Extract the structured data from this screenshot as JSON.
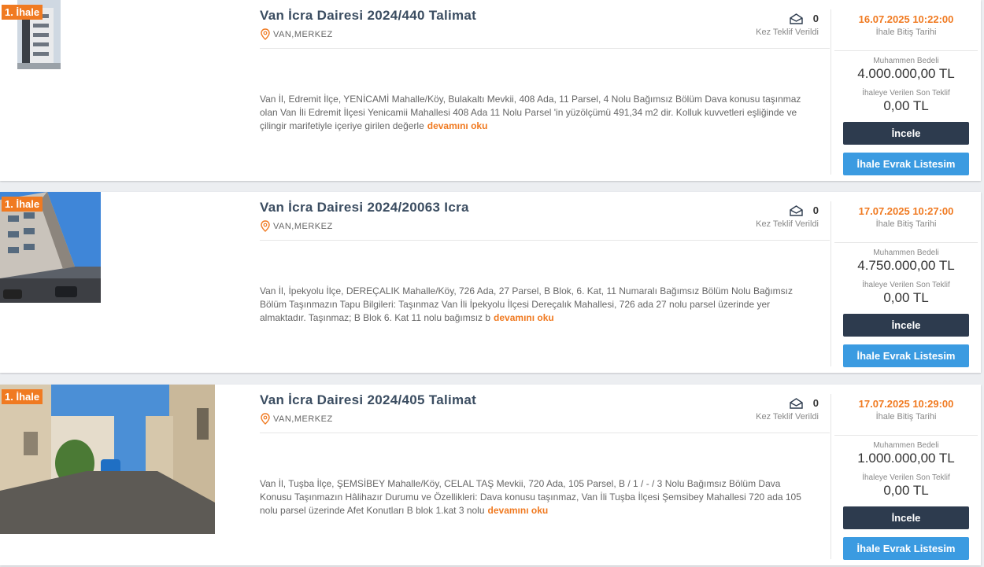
{
  "listings": [
    {
      "badge": "1. İhale",
      "title": "Van İcra Dairesi 2024/440 Talimat",
      "location": "VAN,MERKEZ",
      "offer_count": "0",
      "offer_label": "Kez Teklif Verildi",
      "end_date": "16.07.2025 10:22:00",
      "end_date_label": "İhale Bitiş Tarihi",
      "estimate_label": "Muhammen Bedeli",
      "estimate_value": "4.000.000,00 TL",
      "last_offer_label": "İhaleye Verilen Son Teklif",
      "last_offer_value": "0,00 TL",
      "description": "Van İl, Edremit İlçe, YENİCAMİ Mahalle/Köy, Bulakaltı Mevkii, 408 Ada, 11 Parsel, 4 Nolu Bağımsız Bölüm Dava konusu taşınmaz olan Van İli Edremit İlçesi Yenicamii Mahallesi 408 Ada 11 Nolu Parsel 'in yüzölçümü 491,34 m2 dir. Kolluk kuvvetleri eşliğinde ve çilingir marifetiyle içeriye girilen değerle",
      "more_label": "devamını oku",
      "inspect_label": "İncele",
      "docs_label": "İhale Evrak Listesim"
    },
    {
      "badge": "1. İhale",
      "title": "Van İcra Dairesi 2024/20063 Icra",
      "location": "VAN,MERKEZ",
      "offer_count": "0",
      "offer_label": "Kez Teklif Verildi",
      "end_date": "17.07.2025 10:27:00",
      "end_date_label": "İhale Bitiş Tarihi",
      "estimate_label": "Muhammen Bedeli",
      "estimate_value": "4.750.000,00 TL",
      "last_offer_label": "İhaleye Verilen Son Teklif",
      "last_offer_value": "0,00 TL",
      "description": "Van İl, İpekyolu İlçe, DEREÇALIK Mahalle/Köy, 726 Ada, 27 Parsel, B Blok, 6. Kat, 11 Numaralı Bağımsız Bölüm Nolu Bağımsız Bölüm Taşınmazın Tapu Bilgileri: Taşınmaz Van İli İpekyolu İlçesi Dereçalık Mahallesi, 726 ada 27 nolu parsel üzerinde yer almaktadır. Taşınmaz; B Blok 6. Kat 11 nolu bağımsız b",
      "more_label": "devamını oku",
      "inspect_label": "İncele",
      "docs_label": "İhale Evrak Listesim"
    },
    {
      "badge": "1. İhale",
      "title": "Van İcra Dairesi 2024/405 Talimat",
      "location": "VAN,MERKEZ",
      "offer_count": "0",
      "offer_label": "Kez Teklif Verildi",
      "end_date": "17.07.2025 10:29:00",
      "end_date_label": "İhale Bitiş Tarihi",
      "estimate_label": "Muhammen Bedeli",
      "estimate_value": "1.000.000,00 TL",
      "last_offer_label": "İhaleye Verilen Son Teklif",
      "last_offer_value": "0,00 TL",
      "description": "Van İl, Tuşba İlçe, ŞEMSİBEY Mahalle/Köy, CELAL TAŞ Mevkii, 720 Ada, 105 Parsel, B / 1 / - / 3 Nolu Bağımsız Bölüm Dava Konusu Taşınmazın Hâlihazır Durumu ve Özellikleri: Dava konusu taşınmaz, Van İli Tuşba İlçesi Şemsibey Mahallesi 720 ada 105 nolu parsel üzerinde Afet Konutları B blok 1.kat 3 nolu",
      "more_label": "devamını oku",
      "inspect_label": "İncele",
      "docs_label": "İhale Evrak Listesim"
    }
  ],
  "colors": {
    "accent_orange": "#f07a21",
    "button_dark": "#2d3b4e",
    "button_blue": "#3b9be1",
    "title_color": "#3b4d61"
  }
}
